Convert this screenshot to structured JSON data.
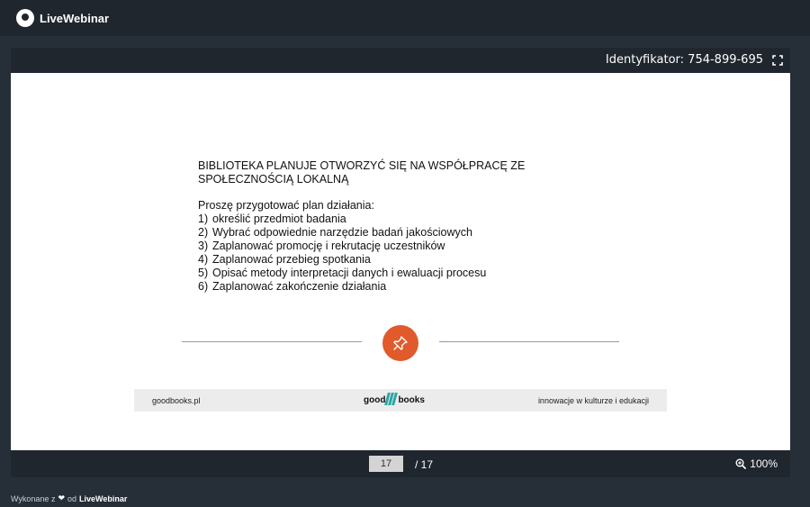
{
  "app": {
    "name": "LiveWebinar"
  },
  "player": {
    "identifier_label": "Identyfikator: 754-899-695"
  },
  "slide": {
    "title_line1": "BIBLIOTEKA PLANUJE OTWORZYĆ SIĘ NA WSPÓŁPRACĘ ZE",
    "title_line2": "SPOŁECZNOŚCIĄ LOKALNĄ",
    "intro": "Proszę przygotować plan działania:",
    "items": [
      {
        "num": "1)",
        "text": "określić przedmiot badania"
      },
      {
        "num": "2)",
        "text": "Wybrać odpowiednie narzędzie badań jakościowych"
      },
      {
        "num": "3)",
        "text": "Zaplanować promocję i rekrutację uczestników"
      },
      {
        "num": "4)",
        "text": "Zaplanować przebieg spotkania"
      },
      {
        "num": "5)",
        "text": "Opisać metody interpretacji danych i ewaluacji procesu"
      },
      {
        "num": "6)",
        "text": "Zaplanować zakończenie działania"
      }
    ],
    "footer_left": "goodbooks.pl",
    "footer_brand_left": "good",
    "footer_brand_right": "books",
    "footer_right": "innowacje w kulturze i edukacji",
    "pin_color": "#e05a2b"
  },
  "pager": {
    "current_page": "17",
    "total": "/ 17"
  },
  "zoom": {
    "level": "100%"
  },
  "credits": {
    "prefix": "Wykonane z",
    "middle": "od",
    "brand": "LiveWebinar"
  }
}
